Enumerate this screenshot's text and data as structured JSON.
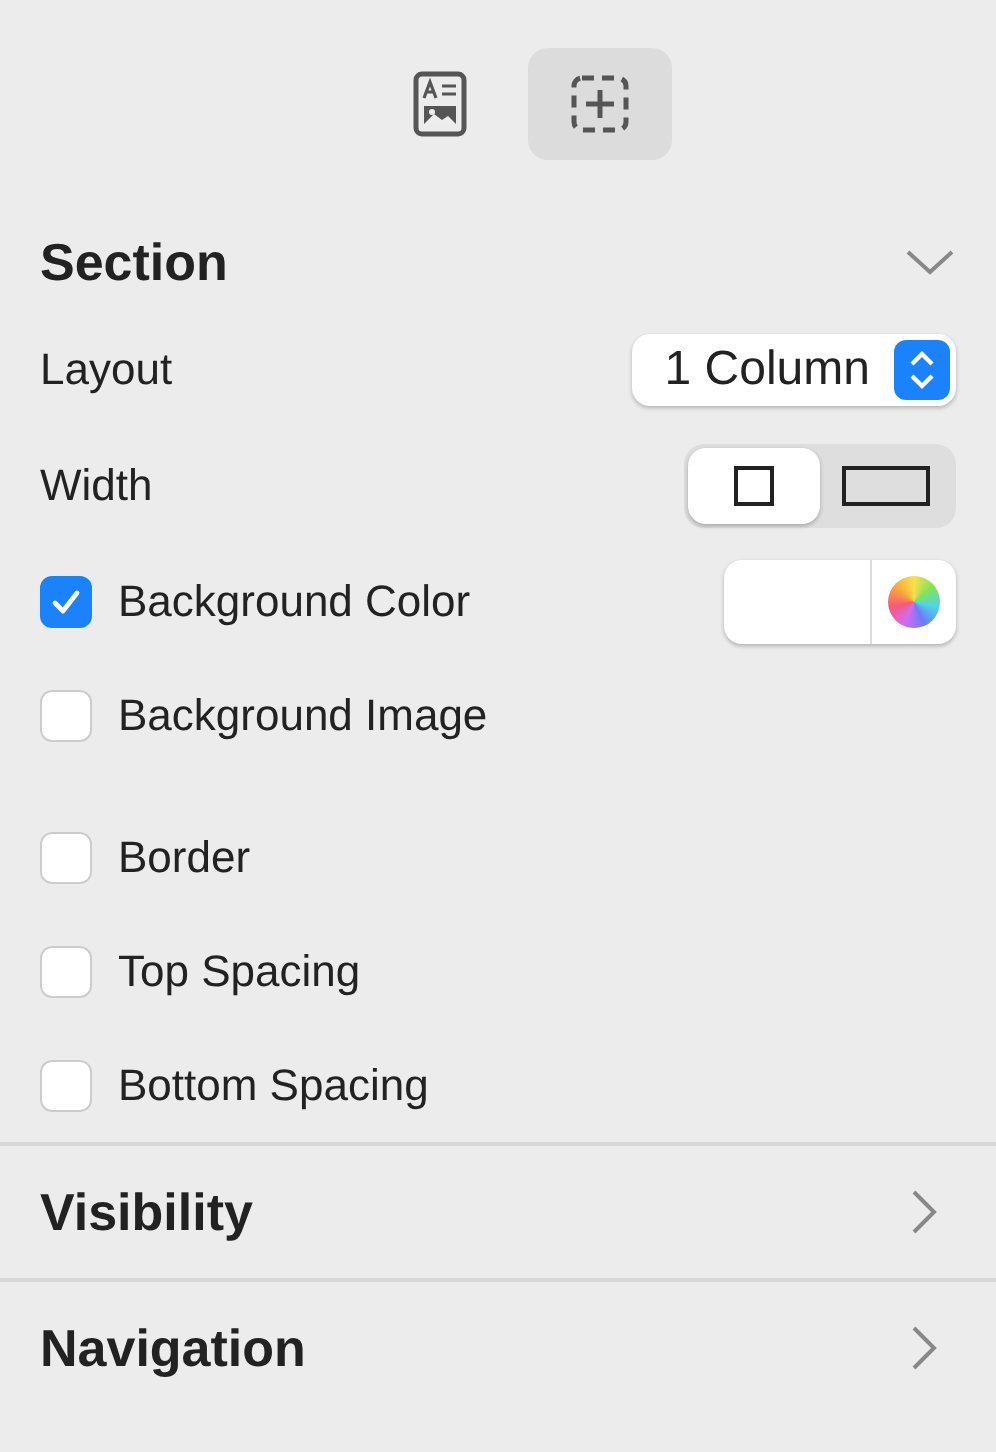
{
  "toolbar": [
    {
      "kind": "document",
      "selected": false
    },
    {
      "kind": "add-block",
      "selected": true
    }
  ],
  "section": {
    "title": "Section",
    "expanded": true,
    "layout": {
      "label": "Layout",
      "value": "1 Column"
    },
    "width": {
      "label": "Width",
      "options": [
        {
          "kind": "narrow",
          "selected": true
        },
        {
          "kind": "wide",
          "selected": false
        }
      ]
    },
    "options": [
      {
        "kind": "color",
        "label": "Background Color",
        "checked": true
      },
      {
        "kind": "plain",
        "label": "Background Image",
        "checked": false
      },
      {
        "kind": "plain",
        "label": "Border",
        "checked": false
      },
      {
        "kind": "plain",
        "label": "Top Spacing",
        "checked": false
      },
      {
        "kind": "plain",
        "label": "Bottom Spacing",
        "checked": false
      }
    ]
  },
  "collapsed_sections": [
    {
      "title": "Visibility",
      "expanded": false
    },
    {
      "title": "Navigation",
      "expanded": false
    }
  ]
}
